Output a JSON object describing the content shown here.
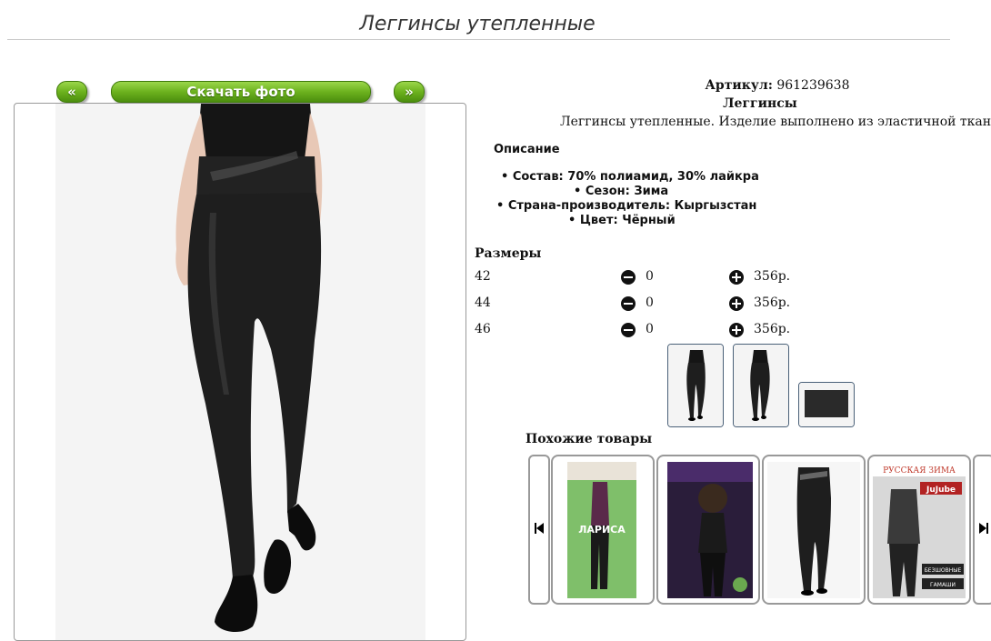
{
  "page": {
    "title": "Леггинсы утепленные"
  },
  "gallery": {
    "prev_label": "«",
    "download_label": "Скачать фото",
    "next_label": "»"
  },
  "product": {
    "article_label": "Артикул:",
    "article_value": "961239638",
    "name": "Леггинсы",
    "short_description": "Леггинсы утепленные. Изделие выполнено из эластичной ткани",
    "description_heading": "Описание",
    "features": [
      "• Состав: 70% полиамид, 30% лайкра",
      "• Сезон: Зима",
      "• Страна-производитель: Кыргызстан",
      "• Цвет: Чёрный"
    ]
  },
  "sizes": {
    "heading": "Размеры",
    "rows": [
      {
        "size": "42",
        "qty": "0",
        "price": "356р."
      },
      {
        "size": "44",
        "qty": "0",
        "price": "356р."
      },
      {
        "size": "46",
        "qty": "0",
        "price": "356р."
      }
    ]
  },
  "similar": {
    "heading": "Похожие товары",
    "items": [
      {
        "img_text": "ЛАРИСА"
      },
      {
        "img_text": ""
      },
      {
        "img_text": ""
      },
      {
        "img_text": "РУССКАЯ ЗИМА",
        "img_text2": "JuJube",
        "img_text3": "БЕЗШОВНЫЕ",
        "img_text4": "ГАМАШИ"
      }
    ]
  },
  "icons": {
    "minus": "minus-circle-icon",
    "plus": "plus-circle-icon",
    "prev": "skip-back-icon",
    "next": "skip-forward-icon"
  },
  "colors": {
    "button_green": "#6cb21e",
    "thumb_border": "#4a6078",
    "leggings": "#1e1e1e"
  }
}
